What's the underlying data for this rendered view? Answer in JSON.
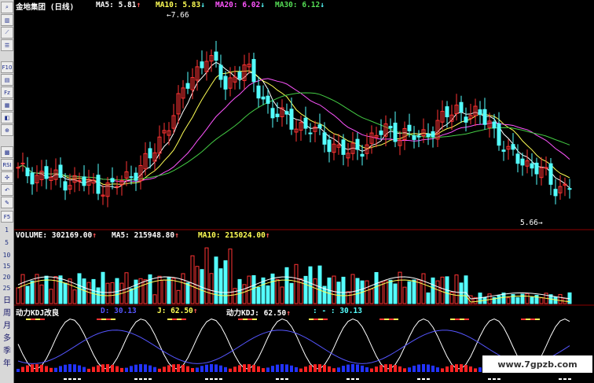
{
  "chart_data": {
    "type": "candlestick",
    "title": "金地集团 (日线)",
    "price_panel": {
      "ma_values": {
        "MA5": "5.81",
        "MA10": "5.83",
        "MA20": "6.02",
        "MA30": "6.12"
      },
      "ma_arrows": {
        "MA5": "↑",
        "MA10": "↓",
        "MA20": "↓",
        "MA30": "↓"
      },
      "annotations": {
        "high": "7.66",
        "low": "5.66"
      },
      "ylim": [
        5.4,
        7.9
      ]
    },
    "volume_panel": {
      "labels": {
        "volume": "VOLUME: 302169.00",
        "ma5": "MA5: 215948.80",
        "ma10": "MA10: 215024.00"
      },
      "arrows": {
        "volume": "↑",
        "ma5": "↑",
        "ma10": "↑"
      },
      "yticks": [
        "5",
        "10",
        "15",
        "20",
        "25",
        "30",
        "35"
      ]
    },
    "kdj_panel": {
      "name": "动力KDJ改良",
      "d_label": "D: 30.13",
      "j_label": "J: 62.50",
      "k_label": "动力KDJ: 62.50",
      "extra_label": ": - : 30.13"
    }
  },
  "toolbar": {
    "icons": [
      "search-icon",
      "chart-icon",
      "list-icon",
      "f10-icon",
      "indicator-icon",
      "draw-icon",
      "ruler-icon",
      "zoom-icon",
      "grid-icon",
      "rsi-icon",
      "move-icon",
      "undo-icon",
      "pen-icon",
      "f5-icon"
    ],
    "btn_text": {
      "f10": "F10",
      "fz": "Fz",
      "rsi": "RSI",
      "f5": "F5"
    },
    "periods": [
      "日",
      "周",
      "月",
      "多",
      "季",
      "年"
    ]
  },
  "watermark": "www.7gpzb.com",
  "colors": {
    "up": "#ff3333",
    "down": "#54ffff",
    "ma5": "#ffffff",
    "ma10": "#ffff55",
    "ma20": "#ff55ff",
    "ma30": "#44cc44",
    "grid": "#8b0000",
    "kdj_k": "#ffffff",
    "kdj_d": "#ffff00",
    "kdj_j": "#5555ff"
  }
}
